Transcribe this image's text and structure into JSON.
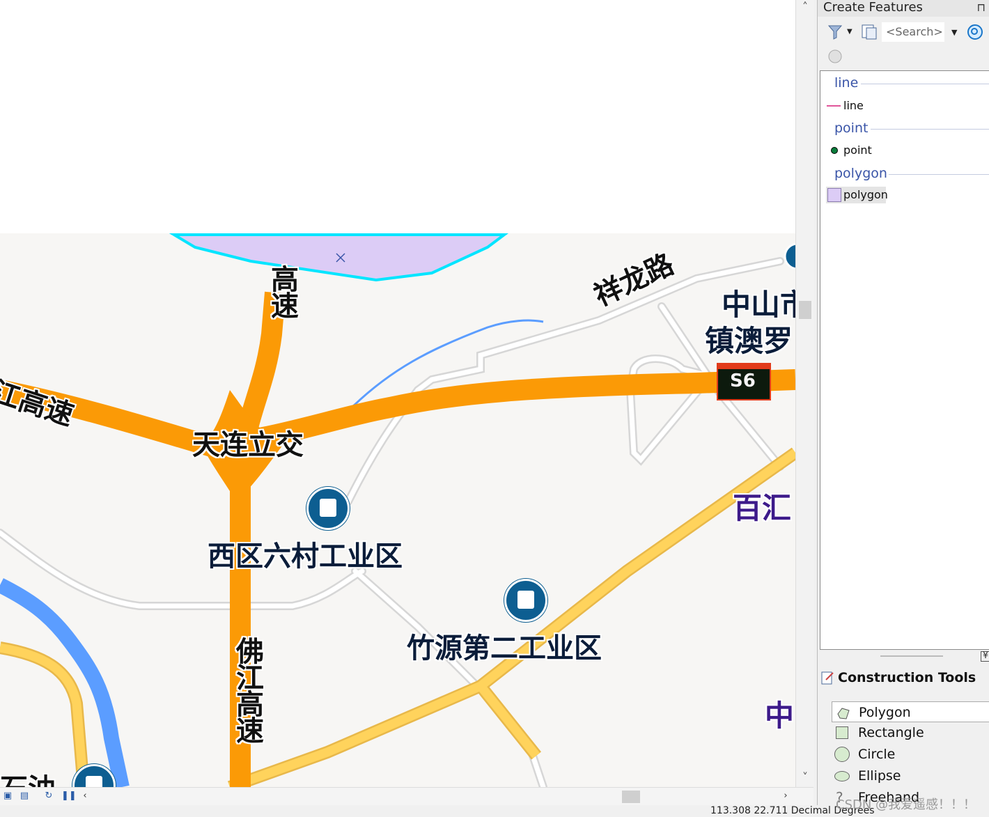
{
  "map": {
    "labels": {
      "xianglong_road": "祥龙路",
      "zhongshan": "中山市",
      "zhen_ao": "镇澳罗",
      "highway_top": "高速",
      "jiang_gaosu": "江高速",
      "tianlian": "天连立交",
      "xiqu": "西区六村工业区",
      "zhuyuan": "竹源第二工业区",
      "baihui": "百汇",
      "zhong": "中",
      "fojiang": "佛江高速",
      "shiyou": "石油",
      "road_shield": "S6"
    }
  },
  "panel": {
    "title": "Create Features",
    "pin_glyph": "⊓",
    "search_placeholder": "<Search>",
    "groups": [
      {
        "name": "line",
        "template": "line"
      },
      {
        "name": "point",
        "template": "point"
      },
      {
        "name": "polygon",
        "template": "polygon"
      }
    ],
    "construction_title": "Construction Tools",
    "tools": [
      {
        "label": "Polygon"
      },
      {
        "label": "Rectangle"
      },
      {
        "label": "Circle"
      },
      {
        "label": "Ellipse"
      },
      {
        "label": "Freehand"
      }
    ]
  },
  "status": {
    "coords": "113.308  22.711 Decimal Degrees"
  },
  "watermark": "CSDN @我爱遥感！！！",
  "colors": {
    "highway": "#fb9a06",
    "secondary": "#ffd35c",
    "river": "#5b9dff",
    "polygon_fill": "#dcccf6",
    "polygon_edge": "#00e5ff",
    "poi": "#0d5e91"
  }
}
